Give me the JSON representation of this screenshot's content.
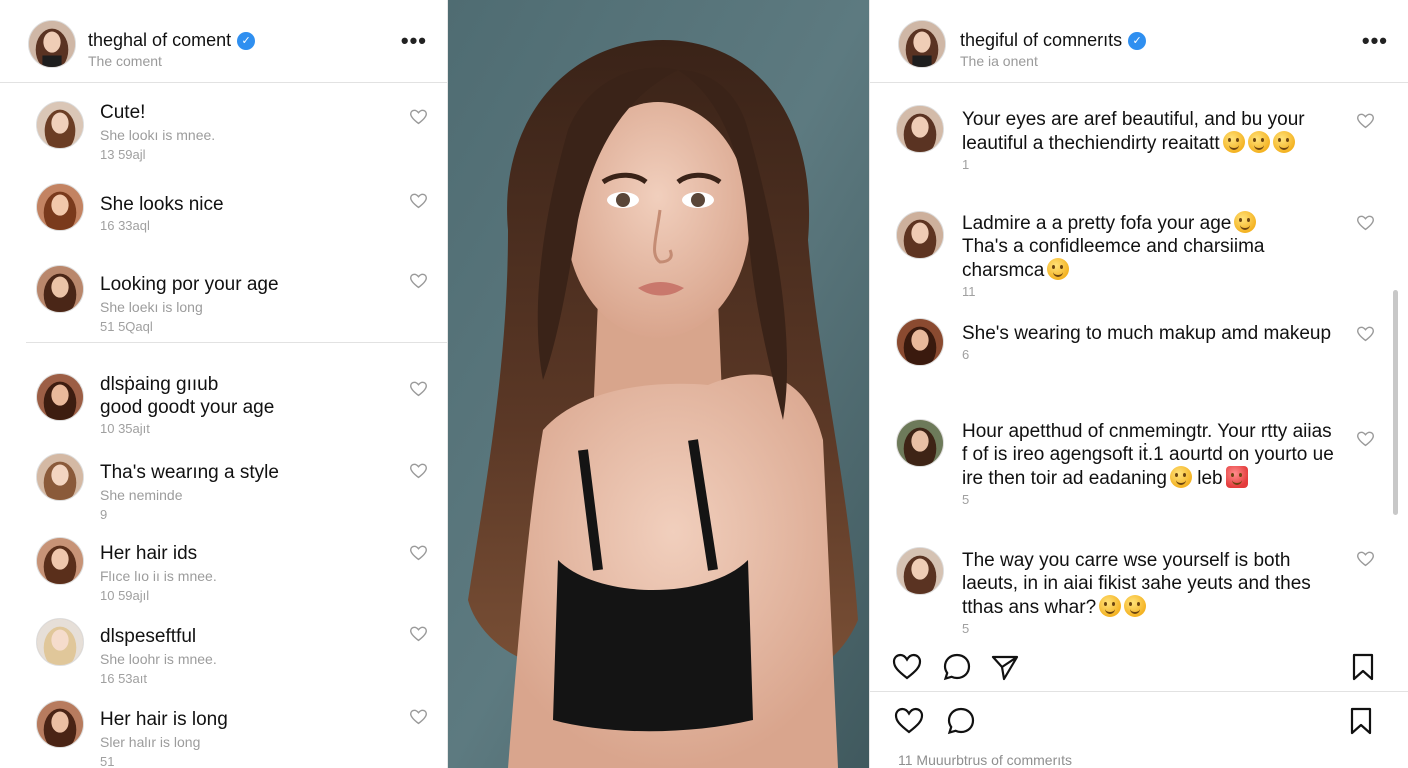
{
  "left_panel": {
    "username": "theghal of coment",
    "subtitle": "The coment",
    "more_label": "•••",
    "comments": [
      {
        "text": "Cute!",
        "meta": "She lookı is mnee.",
        "meta2": "13      59ajl"
      },
      {
        "text": "She looks nice",
        "meta": "",
        "meta2": "16      33aql"
      },
      {
        "text": "Looking por your age",
        "meta": "She loekı is long",
        "meta2": "51      5Qaql"
      },
      {
        "text": "dlsṗaing gııub\ngood goodt your age",
        "meta": "",
        "meta2": "10      35ajıt"
      },
      {
        "text": "Tha's wearıng a style",
        "meta": "She neminde",
        "meta2": "9"
      },
      {
        "text": "Her hair ids",
        "meta": "Flıce lıo iı is mnee.",
        "meta2": "10      59ajıl"
      },
      {
        "text": "dlspeseftful",
        "meta": "She loohr is mnee.",
        "meta2": "16      53aıt"
      },
      {
        "text": "Her hair is long",
        "meta": "Sler halır is long",
        "meta2": "51"
      }
    ]
  },
  "right_panel": {
    "username": "thegiful of comnerıts",
    "subtitle": "The ia onent",
    "more_label": "•••",
    "comments": [
      {
        "text": "Your eyes are aref beautiful, and bu your leautiful a thechiendirty reaitatt",
        "emojis": 3,
        "meta": "1"
      },
      {
        "text": "Ladmire a a pretty fofa your age",
        "text2": "Tha's a confidleemce and charsiima charsmca",
        "emojis": 1,
        "meta": "11"
      },
      {
        "text": "She's wearing to much makup amd makeup",
        "emojis": 0,
        "meta": "6"
      },
      {
        "text": "Hour apetthud of cnmemingtr. Your rtty aiias f of is ireo agengsoft iṫ.1 aourtd on yourto ue ire then toir ad eadaning",
        "text_end": "leb",
        "emojis": 1,
        "meta": "5"
      },
      {
        "text": "The way you carre wse yourself is both laeuts, in in aiai fikist ɜahe yeuts and thes tthas ans whar?",
        "emojis": 2,
        "meta": "5"
      }
    ],
    "footer": "11 Muuurbtrus of commerıts"
  },
  "colors": {
    "verified": "#2f8ff0",
    "background": "#ffffff",
    "photo_background": "#56737a"
  }
}
